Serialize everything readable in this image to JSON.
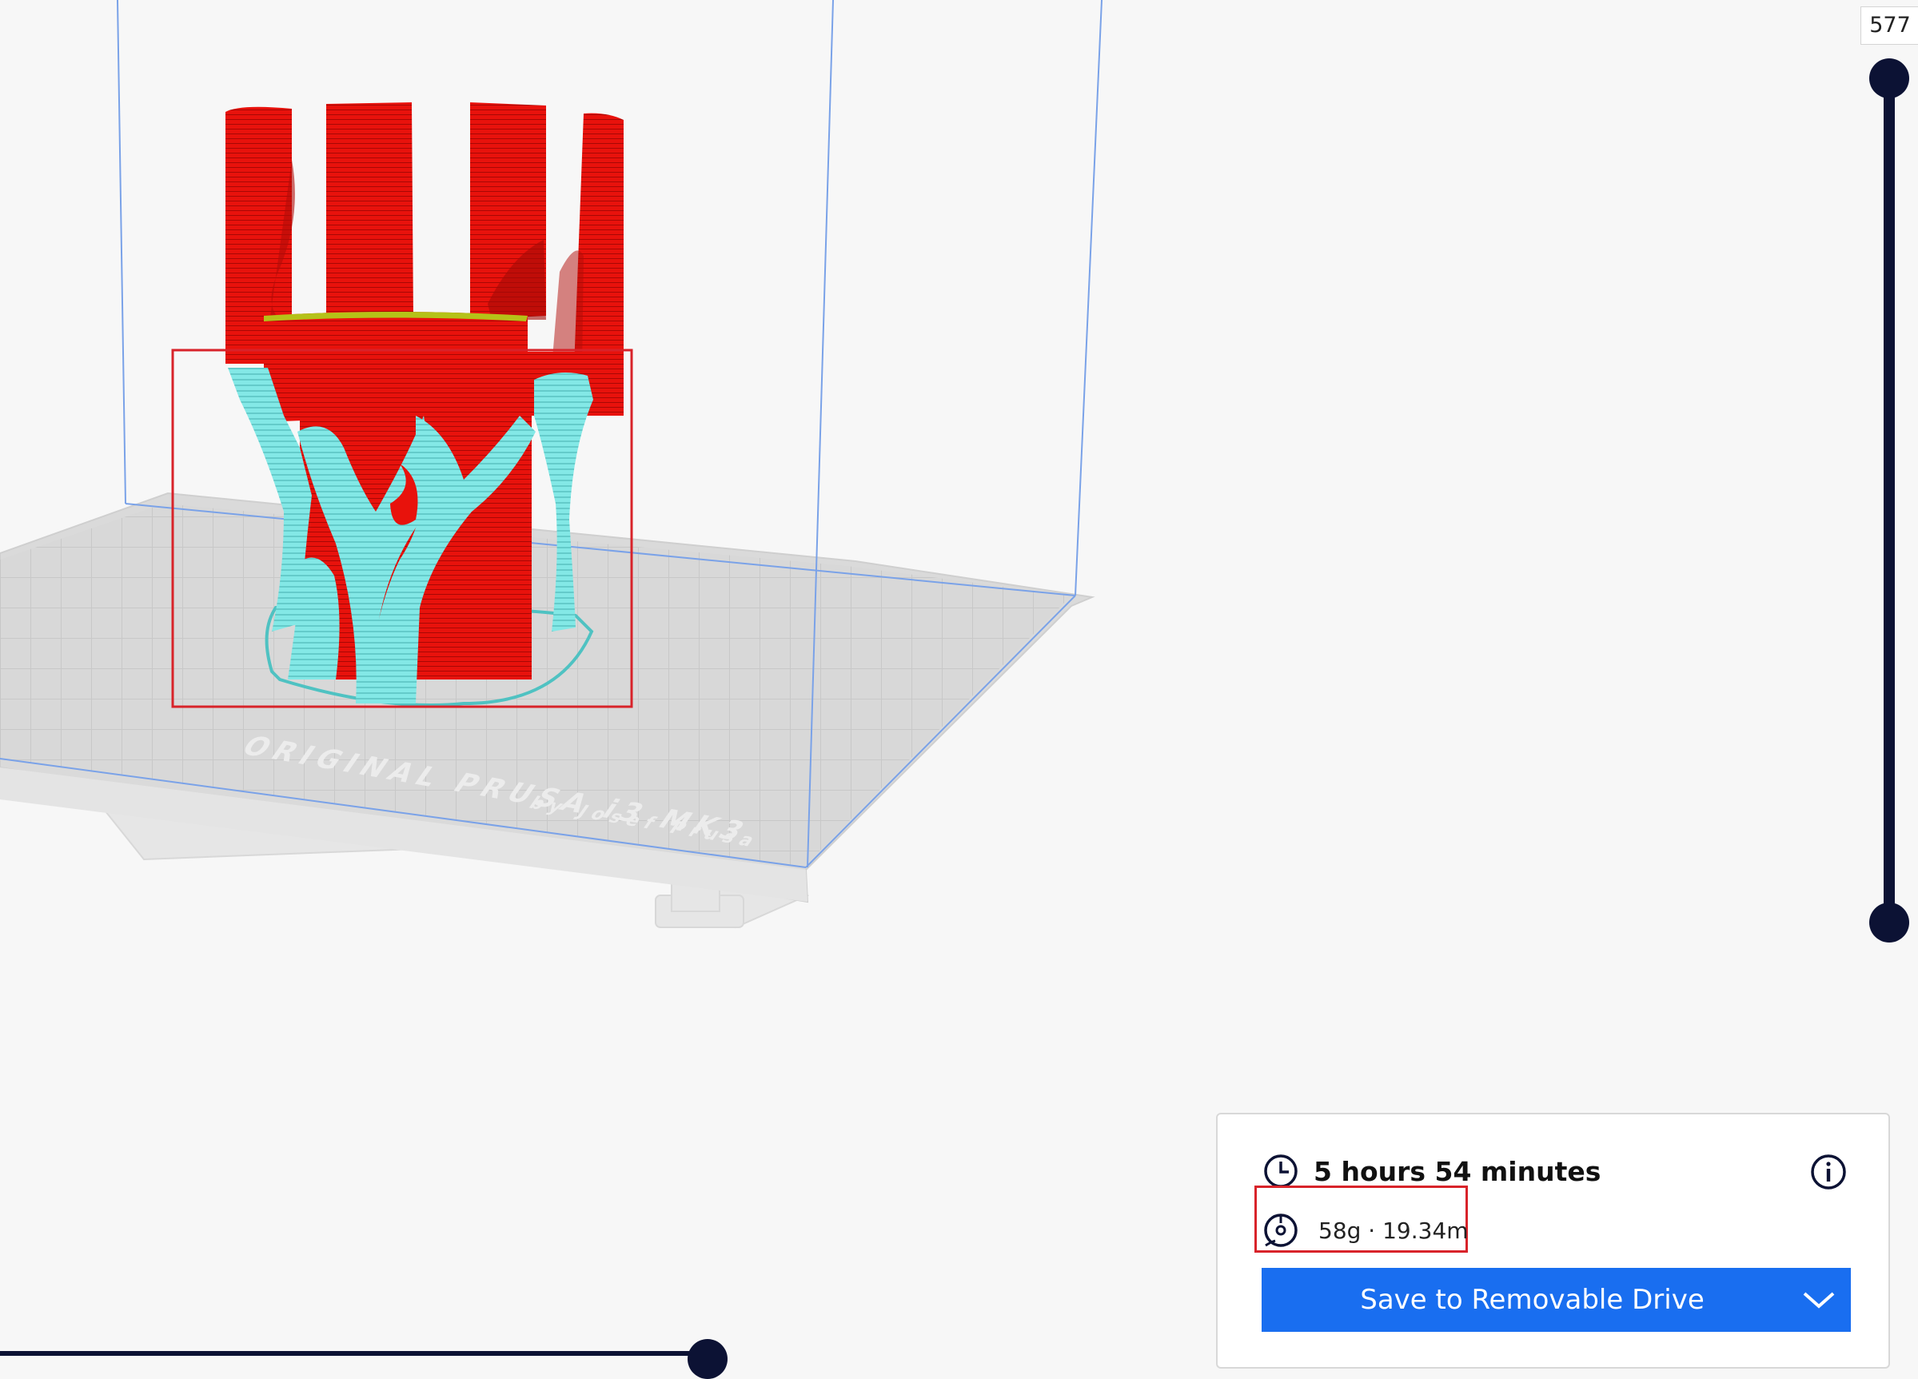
{
  "layer_slider": {
    "top_value": "577"
  },
  "print_summary": {
    "time": "5 hours 54 minutes",
    "material": "58g · 19.34m",
    "save_label": "Save to Removable Drive"
  },
  "bed_text": {
    "line1": "ORIGINAL PRUSA i3 MK3",
    "line2": "by Josef Prusa"
  },
  "colors": {
    "model": "#e8120c",
    "support": "#7de6e6",
    "accent": "#196ef0",
    "slider": "#0c1234",
    "highlight": "#d8232a"
  },
  "icons": [
    "clock-icon",
    "spool-icon",
    "info-icon",
    "chevron-down-icon"
  ]
}
